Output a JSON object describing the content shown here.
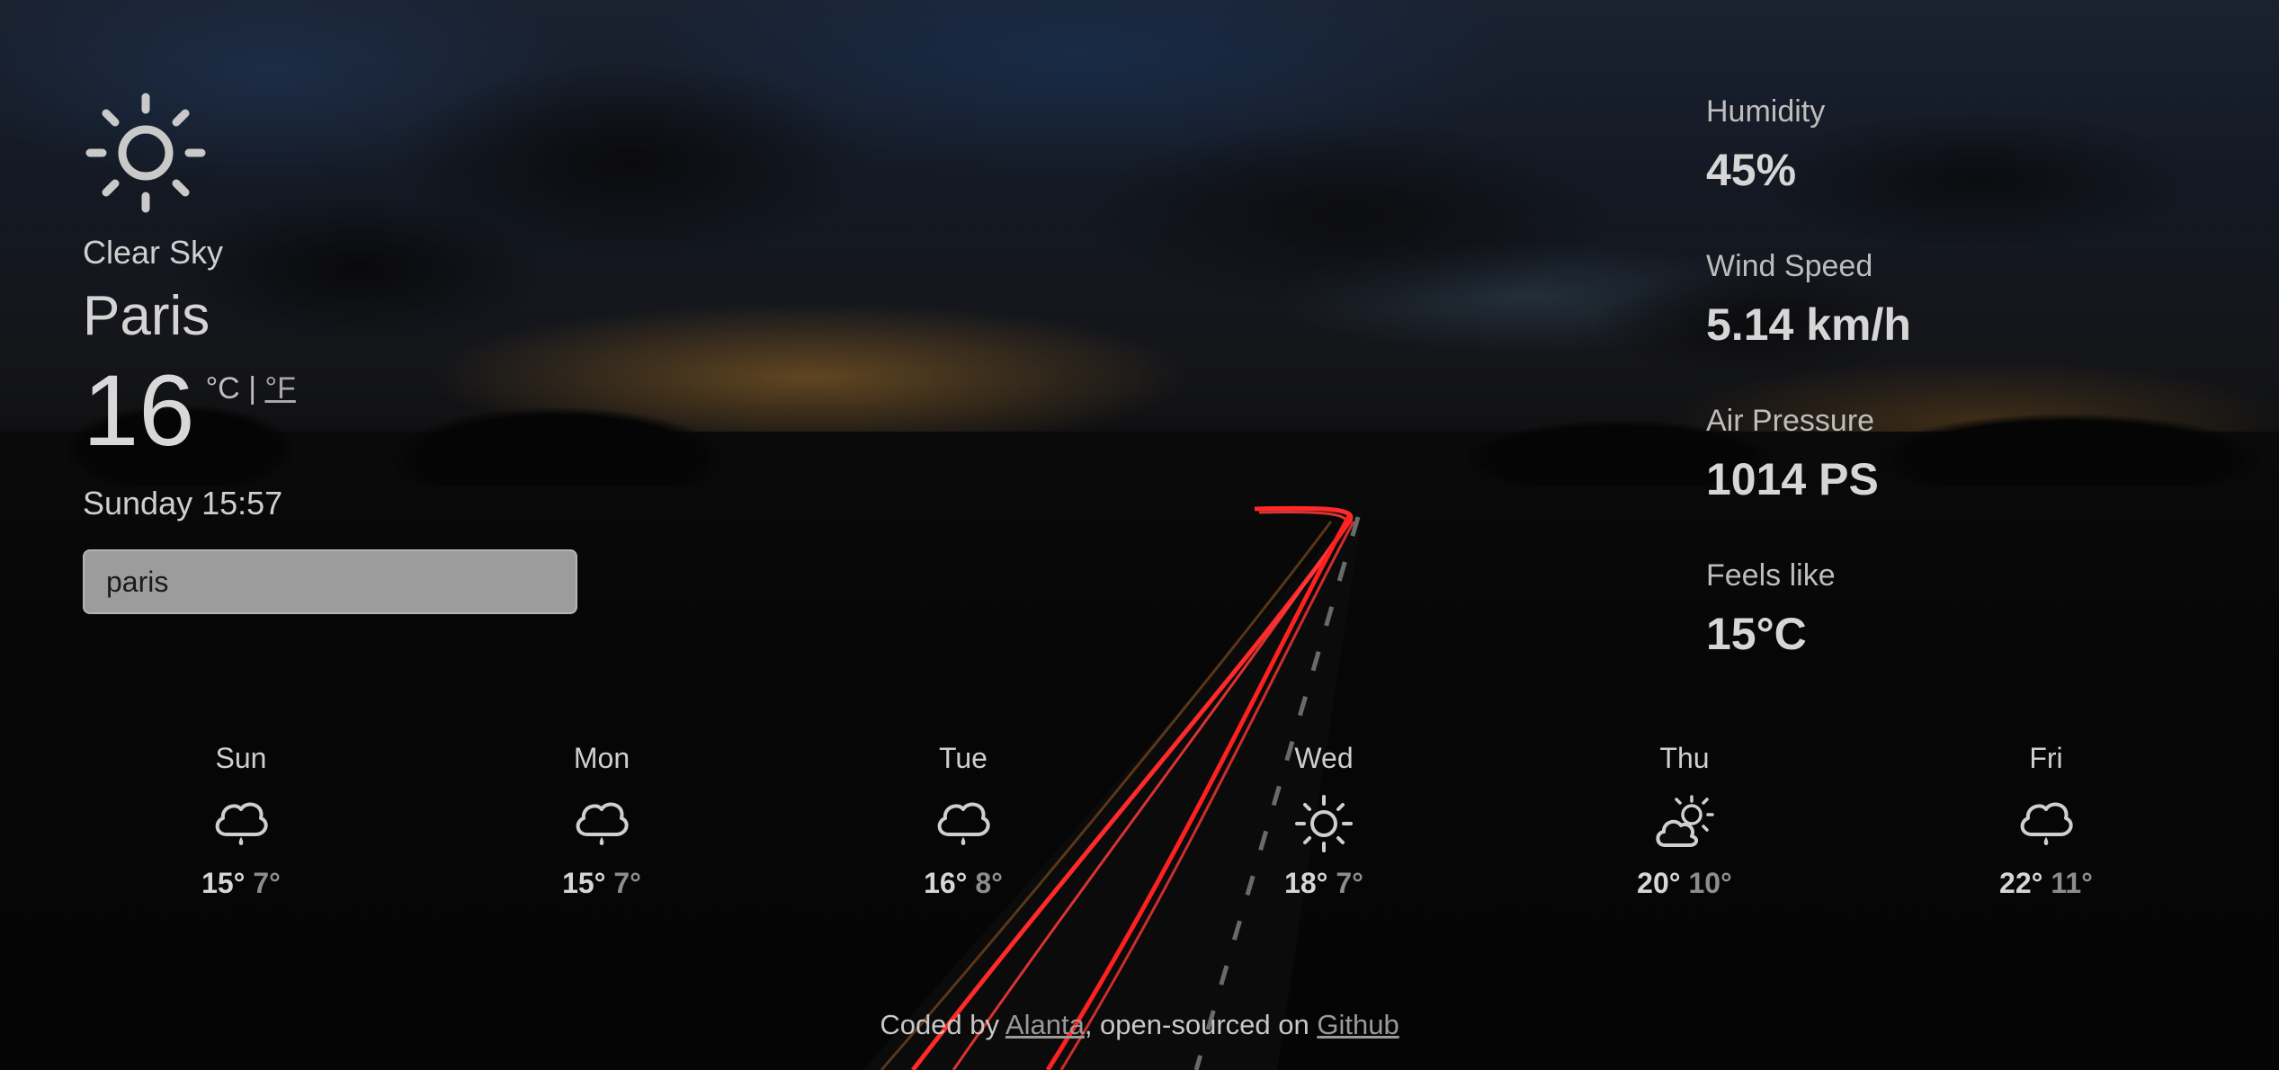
{
  "current": {
    "icon": "sun-icon",
    "description": "Clear Sky",
    "city": "Paris",
    "temperature": "16",
    "unit_c": "°C",
    "unit_separator": "|",
    "unit_f": "°F",
    "datetime": "Sunday 15:57"
  },
  "search": {
    "value": "paris"
  },
  "details": {
    "humidity": {
      "label": "Humidity",
      "value": "45%"
    },
    "wind": {
      "label": "Wind Speed",
      "value": "5.14 km/h"
    },
    "pressure": {
      "label": "Air Pressure",
      "value": "1014 PS"
    },
    "feels": {
      "label": "Feels like",
      "value": "15°C"
    }
  },
  "forecast": [
    {
      "day": "Sun",
      "icon": "rain-cloud-icon",
      "max": "15°",
      "min": "7°"
    },
    {
      "day": "Mon",
      "icon": "rain-cloud-icon",
      "max": "15°",
      "min": "7°"
    },
    {
      "day": "Tue",
      "icon": "rain-cloud-icon",
      "max": "16°",
      "min": "8°"
    },
    {
      "day": "Wed",
      "icon": "sun-icon",
      "max": "18°",
      "min": "7°"
    },
    {
      "day": "Thu",
      "icon": "partly-cloudy-icon",
      "max": "20°",
      "min": "10°"
    },
    {
      "day": "Fri",
      "icon": "rain-cloud-icon",
      "max": "22°",
      "min": "11°"
    }
  ],
  "footer": {
    "prefix": "Coded by ",
    "author": "Alanta",
    "middle": ", open-sourced on ",
    "repo": "Github"
  },
  "colors": {
    "text": "#cfcfcf",
    "muted": "#8d8d8d",
    "search_bg": "#9c9c9c",
    "trail": "#ff2424"
  }
}
